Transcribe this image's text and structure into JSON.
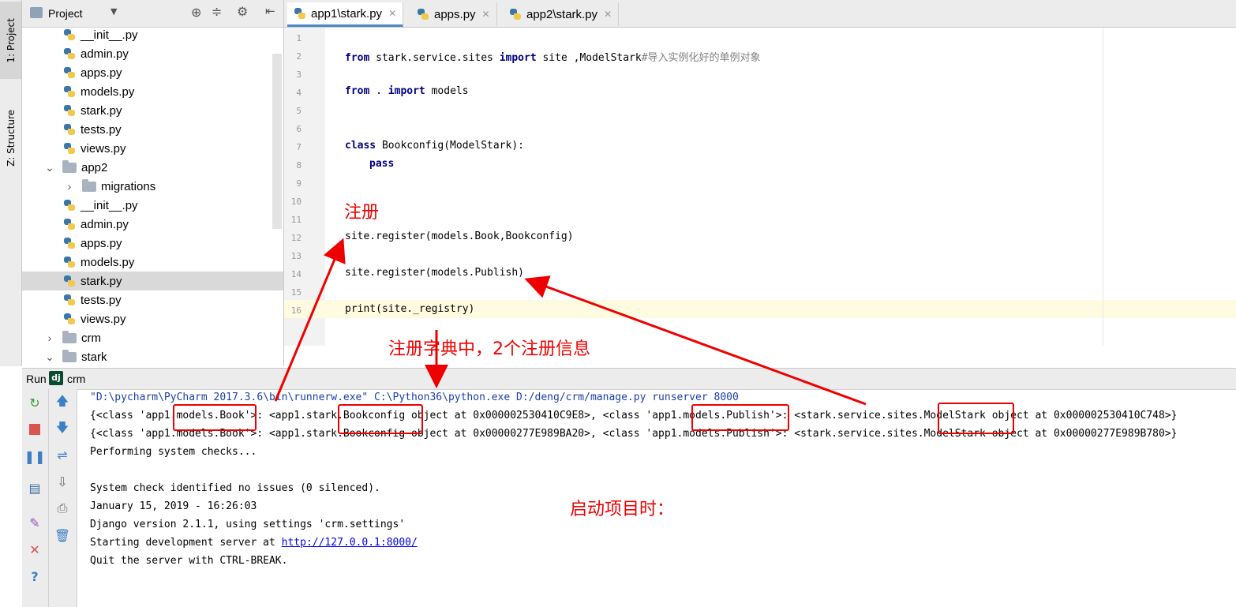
{
  "toolstrip": {
    "project_tab": "1: Project",
    "structure_tab": "Z: Structure"
  },
  "project": {
    "header_label": "Project",
    "tree": [
      {
        "type": "file",
        "label": "__init__.py",
        "indent": 1
      },
      {
        "type": "file",
        "label": "admin.py",
        "indent": 1
      },
      {
        "type": "file",
        "label": "apps.py",
        "indent": 1
      },
      {
        "type": "file",
        "label": "models.py",
        "indent": 1
      },
      {
        "type": "file",
        "label": "stark.py",
        "indent": 1
      },
      {
        "type": "file",
        "label": "tests.py",
        "indent": 1
      },
      {
        "type": "file",
        "label": "views.py",
        "indent": 1
      },
      {
        "type": "folder",
        "label": "app2",
        "indent": 0,
        "expanded": true
      },
      {
        "type": "folder",
        "label": "migrations",
        "indent": 1,
        "expanded": false
      },
      {
        "type": "file",
        "label": "__init__.py",
        "indent": 1
      },
      {
        "type": "file",
        "label": "admin.py",
        "indent": 1
      },
      {
        "type": "file",
        "label": "apps.py",
        "indent": 1
      },
      {
        "type": "file",
        "label": "models.py",
        "indent": 1
      },
      {
        "type": "file",
        "label": "stark.py",
        "indent": 1,
        "selected": true
      },
      {
        "type": "file",
        "label": "tests.py",
        "indent": 1
      },
      {
        "type": "file",
        "label": "views.py",
        "indent": 1
      },
      {
        "type": "folder",
        "label": "crm",
        "indent": 0,
        "expanded": false
      },
      {
        "type": "folder",
        "label": "stark",
        "indent": 0,
        "expanded": true
      }
    ]
  },
  "editor": {
    "tabs": [
      {
        "label": "app1\\stark.py",
        "active": true
      },
      {
        "label": "apps.py",
        "active": false
      },
      {
        "label": "app2\\stark.py",
        "active": false
      }
    ],
    "line_numbers": [
      "1",
      "2",
      "3",
      "4",
      "5",
      "6",
      "7",
      "8",
      "9",
      "10",
      "11",
      "12",
      "13",
      "14",
      "15",
      "16"
    ],
    "code": {
      "l2_kw1": "from",
      "l2_a": " stark.service.sites ",
      "l2_kw2": "import",
      "l2_b": " site ,ModelStark",
      "l2_comment": "#导入实例化好的单例对象",
      "l4_kw1": "from",
      "l4_a": " . ",
      "l4_kw2": "import",
      "l4_b": " models",
      "l7_kw": "class",
      "l7_a": " Bookconfig(ModelStark):",
      "l8_kw": "pass",
      "l12": "site.register(models.Book,Bookconfig)",
      "l14": "site.register(models.Publish)",
      "l16": "print(site._registry)"
    }
  },
  "run": {
    "label": "Run",
    "config": "crm",
    "console": [
      "\"D:\\pycharm\\PyCharm 2017.3.6\\bin\\runnerw.exe\" C:\\Python36\\python.exe D:/deng/crm/manage.py runserver 8000",
      "{<class 'app1.models.Book'>: <app1.stark.Bookconfig object at 0x000002530410C9E8>, <class 'app1.models.Publish'>: <stark.service.sites.ModelStark object at 0x000002530410C748>}",
      "{<class 'app1.models.Book'>: <app1.stark.Bookconfig object at 0x00000277E989BA20>, <class 'app1.models.Publish'>: <stark.service.sites.ModelStark object at 0x00000277E989B780>}",
      "Performing system checks...",
      "",
      "System check identified no issues (0 silenced).",
      "January 15, 2019 - 16:26:03",
      "Django version 2.1.1, using settings 'crm.settings'",
      "Starting development server at ",
      "Quit the server with CTRL-BREAK."
    ],
    "server_link": "http://127.0.0.1:8000/"
  },
  "annotations": {
    "register": "注册",
    "registry_info": "注册字典中，2个注册信息",
    "on_start": "启动项目时："
  },
  "colors": {
    "annotation": "#ee0000",
    "keyword": "#000080",
    "link": "#0000ee",
    "selection": "#d9d9d9"
  }
}
